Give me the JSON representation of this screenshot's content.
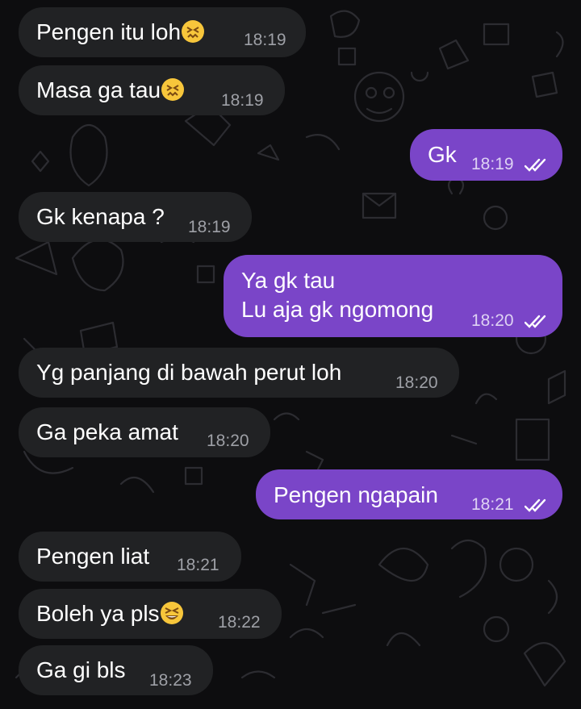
{
  "messages": [
    {
      "id": "m1",
      "direction": "incoming",
      "text": "Pengen itu loh",
      "emoji": "confounded-face-icon",
      "time": "18:19"
    },
    {
      "id": "m2",
      "direction": "incoming",
      "text": "Masa ga tau",
      "emoji": "confounded-face-icon",
      "time": "18:19"
    },
    {
      "id": "m3",
      "direction": "outgoing",
      "text": "Gk",
      "time": "18:19",
      "status": "read"
    },
    {
      "id": "m4",
      "direction": "incoming",
      "text": "Gk kenapa ?",
      "time": "18:19"
    },
    {
      "id": "m5",
      "direction": "outgoing",
      "lines": [
        "Ya gk tau",
        "Lu aja gk ngomong"
      ],
      "time": "18:20",
      "status": "read"
    },
    {
      "id": "m6",
      "direction": "incoming",
      "text": "Yg panjang di bawah perut loh",
      "time": "18:20"
    },
    {
      "id": "m7",
      "direction": "incoming",
      "text": "Ga peka amat",
      "time": "18:20"
    },
    {
      "id": "m8",
      "direction": "outgoing",
      "text": "Pengen ngapain",
      "time": "18:21",
      "status": "read"
    },
    {
      "id": "m9",
      "direction": "incoming",
      "text": "Pengen liat",
      "time": "18:21"
    },
    {
      "id": "m10",
      "direction": "incoming",
      "text": "Boleh ya pls",
      "emoji": "grinning-squinting-face-icon",
      "time": "18:22"
    },
    {
      "id": "m11",
      "direction": "incoming",
      "text": "Ga gi bls",
      "time": "18:23"
    }
  ],
  "colors": {
    "background": "#0d0d0f",
    "incoming_bubble": "#212224",
    "outgoing_bubble": "#7a45c8",
    "incoming_time": "#9ea0a6",
    "outgoing_time": "#ded2f3"
  }
}
